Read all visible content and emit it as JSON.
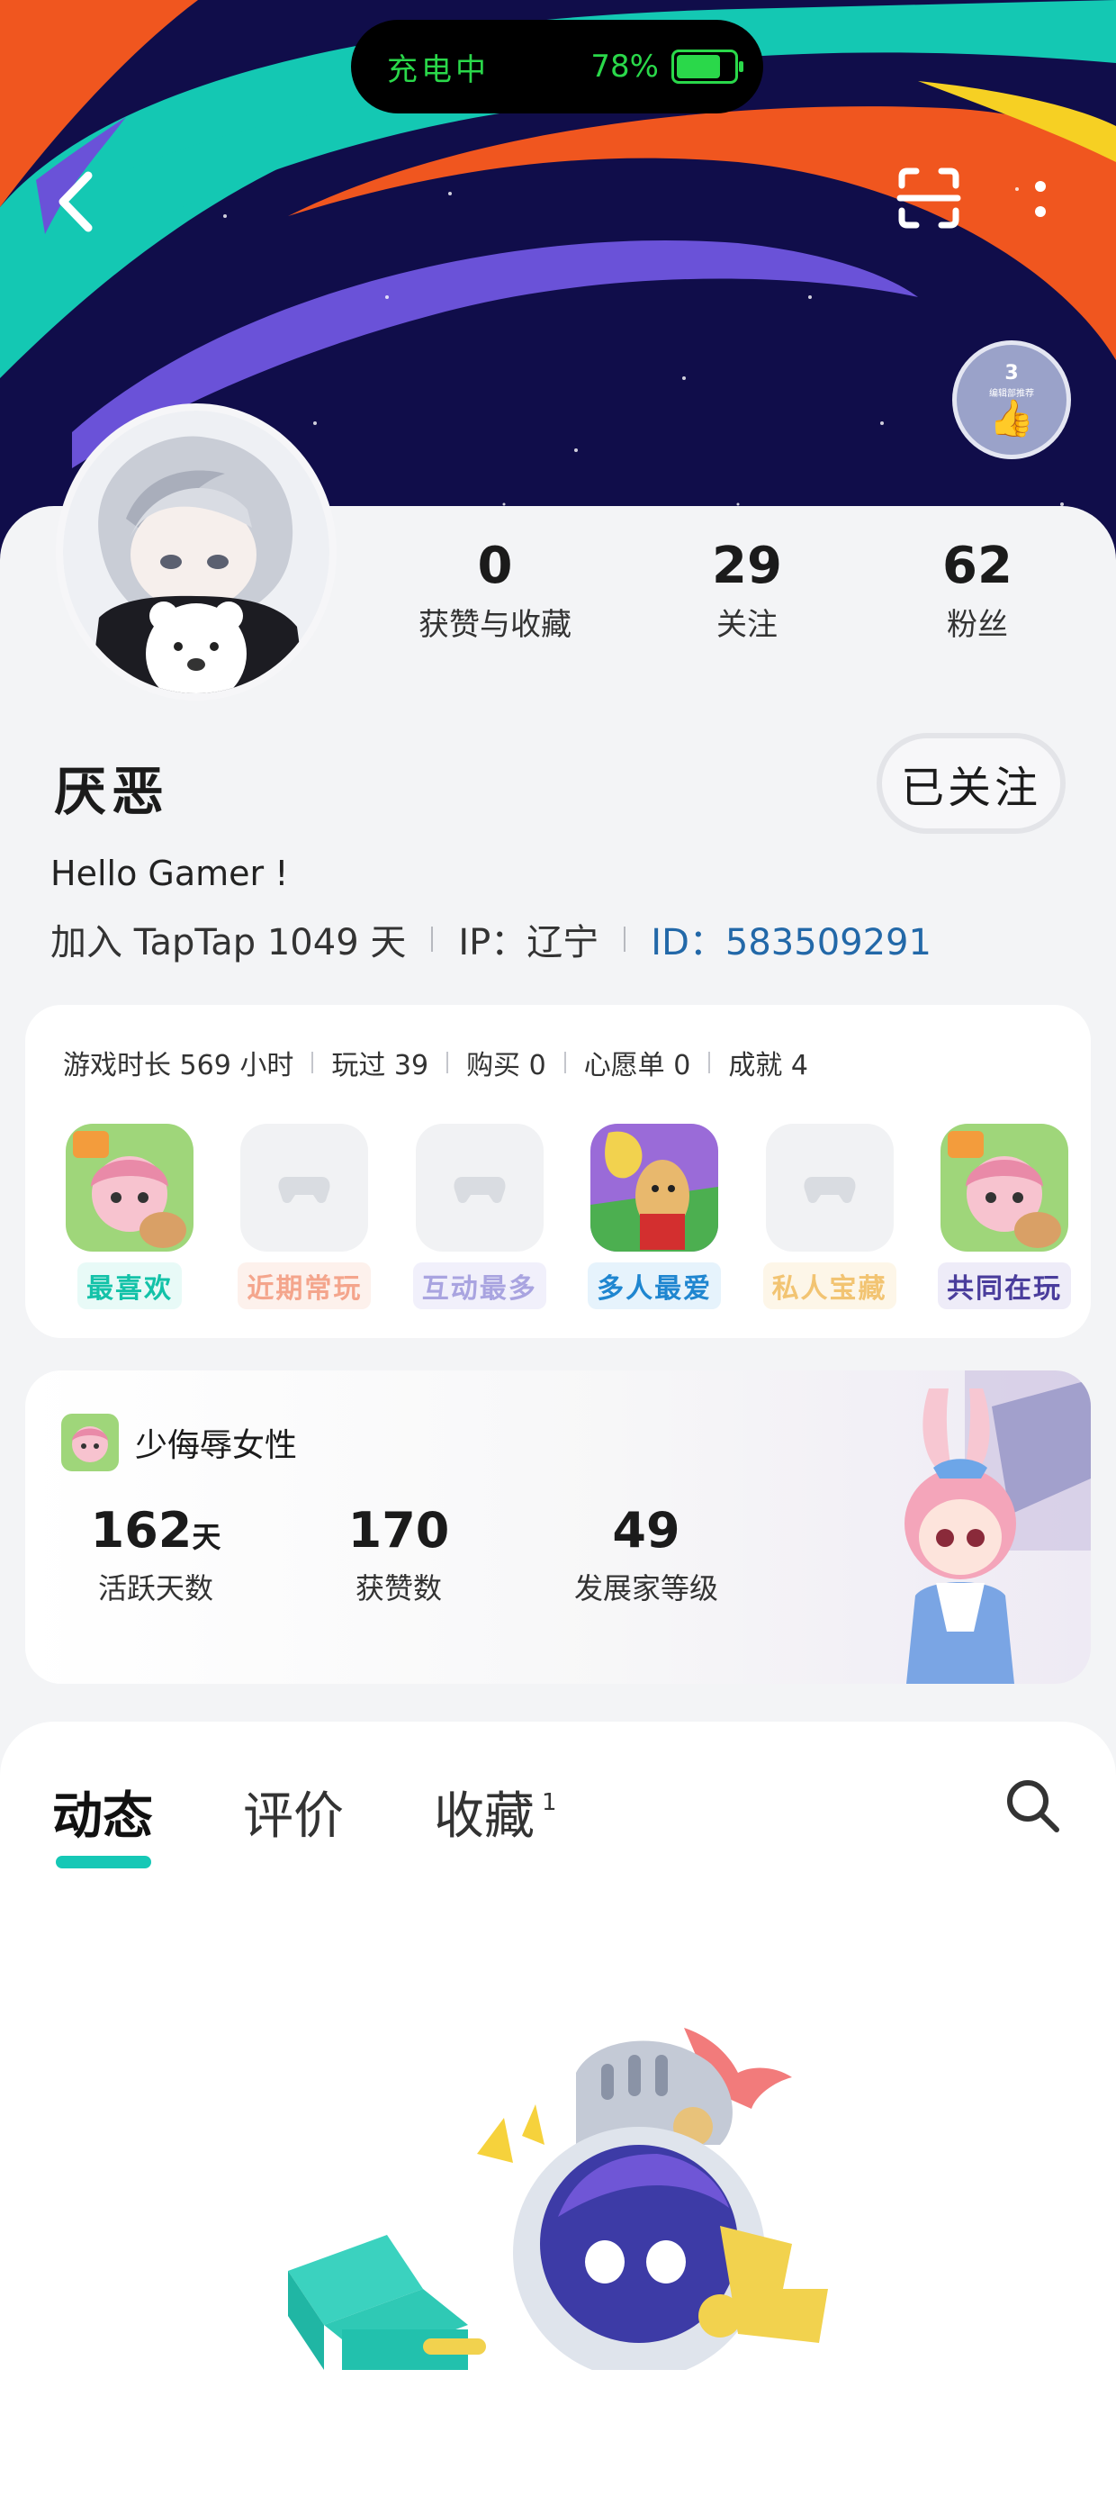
{
  "status_pill": {
    "charging_label": "充电中",
    "battery_pct": "78%",
    "battery_level": 0.78
  },
  "header": {
    "back_icon": "chevron-left-icon",
    "scan_icon": "scan-icon",
    "more_icon": "more-vertical-icon"
  },
  "badge": {
    "level": "3",
    "text": "编辑部推荐"
  },
  "profile": {
    "name": "厌恶",
    "follow_button": "已关注",
    "bio": "Hello Gamer !",
    "joined": "加入 TapTap 1049 天",
    "ip": "IP：辽宁",
    "id": "ID：583509291",
    "stats": [
      {
        "value": "0",
        "label": "获赞与收藏"
      },
      {
        "value": "29",
        "label": "关注"
      },
      {
        "value": "62",
        "label": "粉丝"
      }
    ]
  },
  "games": {
    "stats": [
      "游戏时长 569 小时",
      "玩过 39",
      "购买 0",
      "心愿单 0",
      "成就 4"
    ],
    "tiles": [
      {
        "label": "最喜欢",
        "color": "#13c2a8",
        "bg": "#e8faf7",
        "kind": "game-a"
      },
      {
        "label": "近期常玩",
        "color": "#f4a58c",
        "bg": "#fdf1ec",
        "kind": "empty"
      },
      {
        "label": "互动最多",
        "color": "#a9a4e0",
        "bg": "#f1f0fb",
        "kind": "empty"
      },
      {
        "label": "多人最爱",
        "color": "#1f86d0",
        "bg": "#e6f3fc",
        "kind": "game-b"
      },
      {
        "label": "私人宝藏",
        "color": "#f2c472",
        "bg": "#fdf6e8",
        "kind": "empty"
      },
      {
        "label": "共同在玩",
        "color": "#4a3d9c",
        "bg": "#eeecf8",
        "kind": "game-a"
      }
    ]
  },
  "activity": {
    "game_name": "少侮辱女性",
    "stats": [
      {
        "value": "162",
        "unit": "天",
        "label": "活跃天数"
      },
      {
        "value": "170",
        "unit": "",
        "label": "获赞数"
      },
      {
        "value": "49",
        "unit": "",
        "label": "发展家等级"
      }
    ]
  },
  "tabs": {
    "items": [
      {
        "label": "动态",
        "active": true,
        "count": ""
      },
      {
        "label": "评价",
        "active": false,
        "count": ""
      },
      {
        "label": "收藏",
        "active": false,
        "count": "1"
      }
    ],
    "search_icon": "search-icon"
  }
}
